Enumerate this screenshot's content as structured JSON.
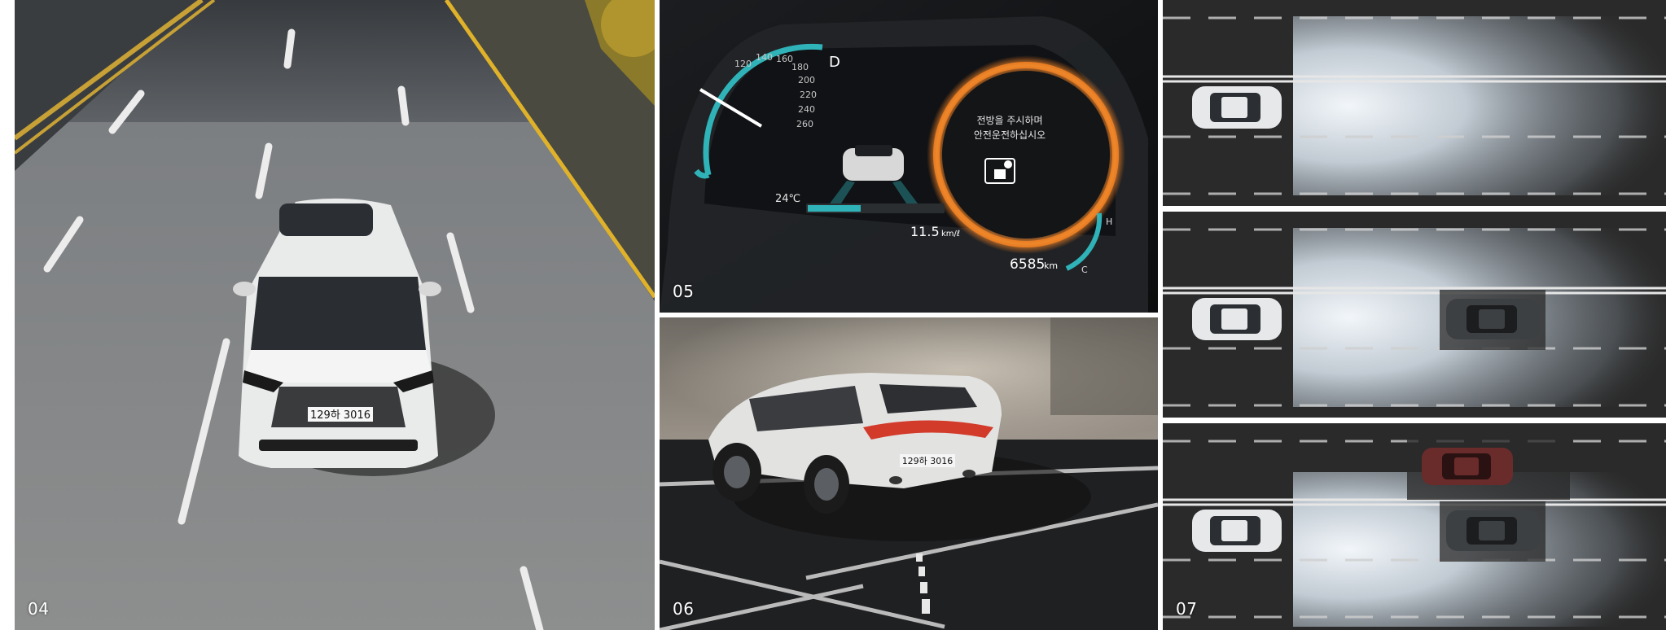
{
  "panels": [
    {
      "number": "04"
    },
    {
      "number": "05"
    },
    {
      "number": "06"
    },
    {
      "number": "07"
    }
  ],
  "car_04": {
    "plate": "129하 3016"
  },
  "car_06": {
    "plate": "129하 3016"
  },
  "cluster": {
    "gear": "D",
    "speed_ticks": [
      "120",
      "140",
      "160",
      "180",
      "200",
      "220",
      "240",
      "260"
    ],
    "warning_line1": "전방을 주시하며",
    "warning_line2": "안전운전하십시오",
    "temperature": "24℃",
    "fuel_economy": "11.5",
    "fuel_economy_unit": "km/ℓ",
    "range": "6585",
    "range_unit": "km",
    "temp_high": "H",
    "temp_low": "C"
  },
  "colors": {
    "cluster_orange": "#e8741c",
    "cluster_teal": "#2fb3b8",
    "road": "#2a2a2a",
    "headlight": "#dfe8f0"
  }
}
